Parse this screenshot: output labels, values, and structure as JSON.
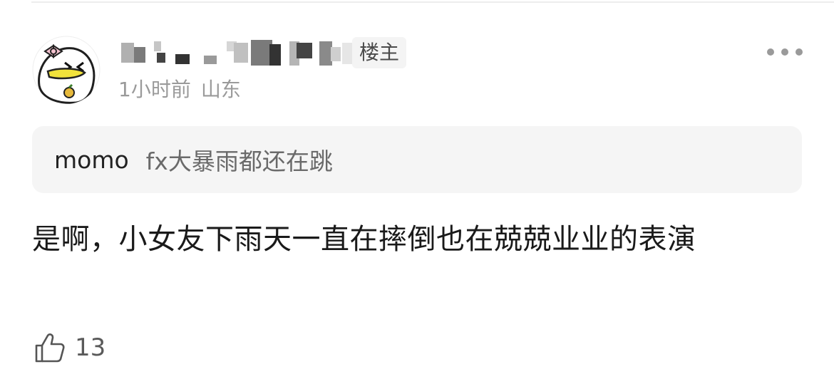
{
  "comment": {
    "author_badge": "楼主",
    "time": "1小时前",
    "location": "山东",
    "quote": {
      "author": "momo",
      "text": "fx大暴雨都还在跳"
    },
    "body": "是啊，小女友下雨天一直在摔倒也在兢兢业业的表演",
    "likes": "13"
  },
  "icons": {
    "avatar": "cartoon-avatar-with-bow",
    "more": "more-horizontal-icon",
    "like": "thumbs-up-icon"
  },
  "colors": {
    "meta_text": "#9a9a9a",
    "quote_bg": "#f5f5f5",
    "badge_bg": "#f4f4f4"
  }
}
